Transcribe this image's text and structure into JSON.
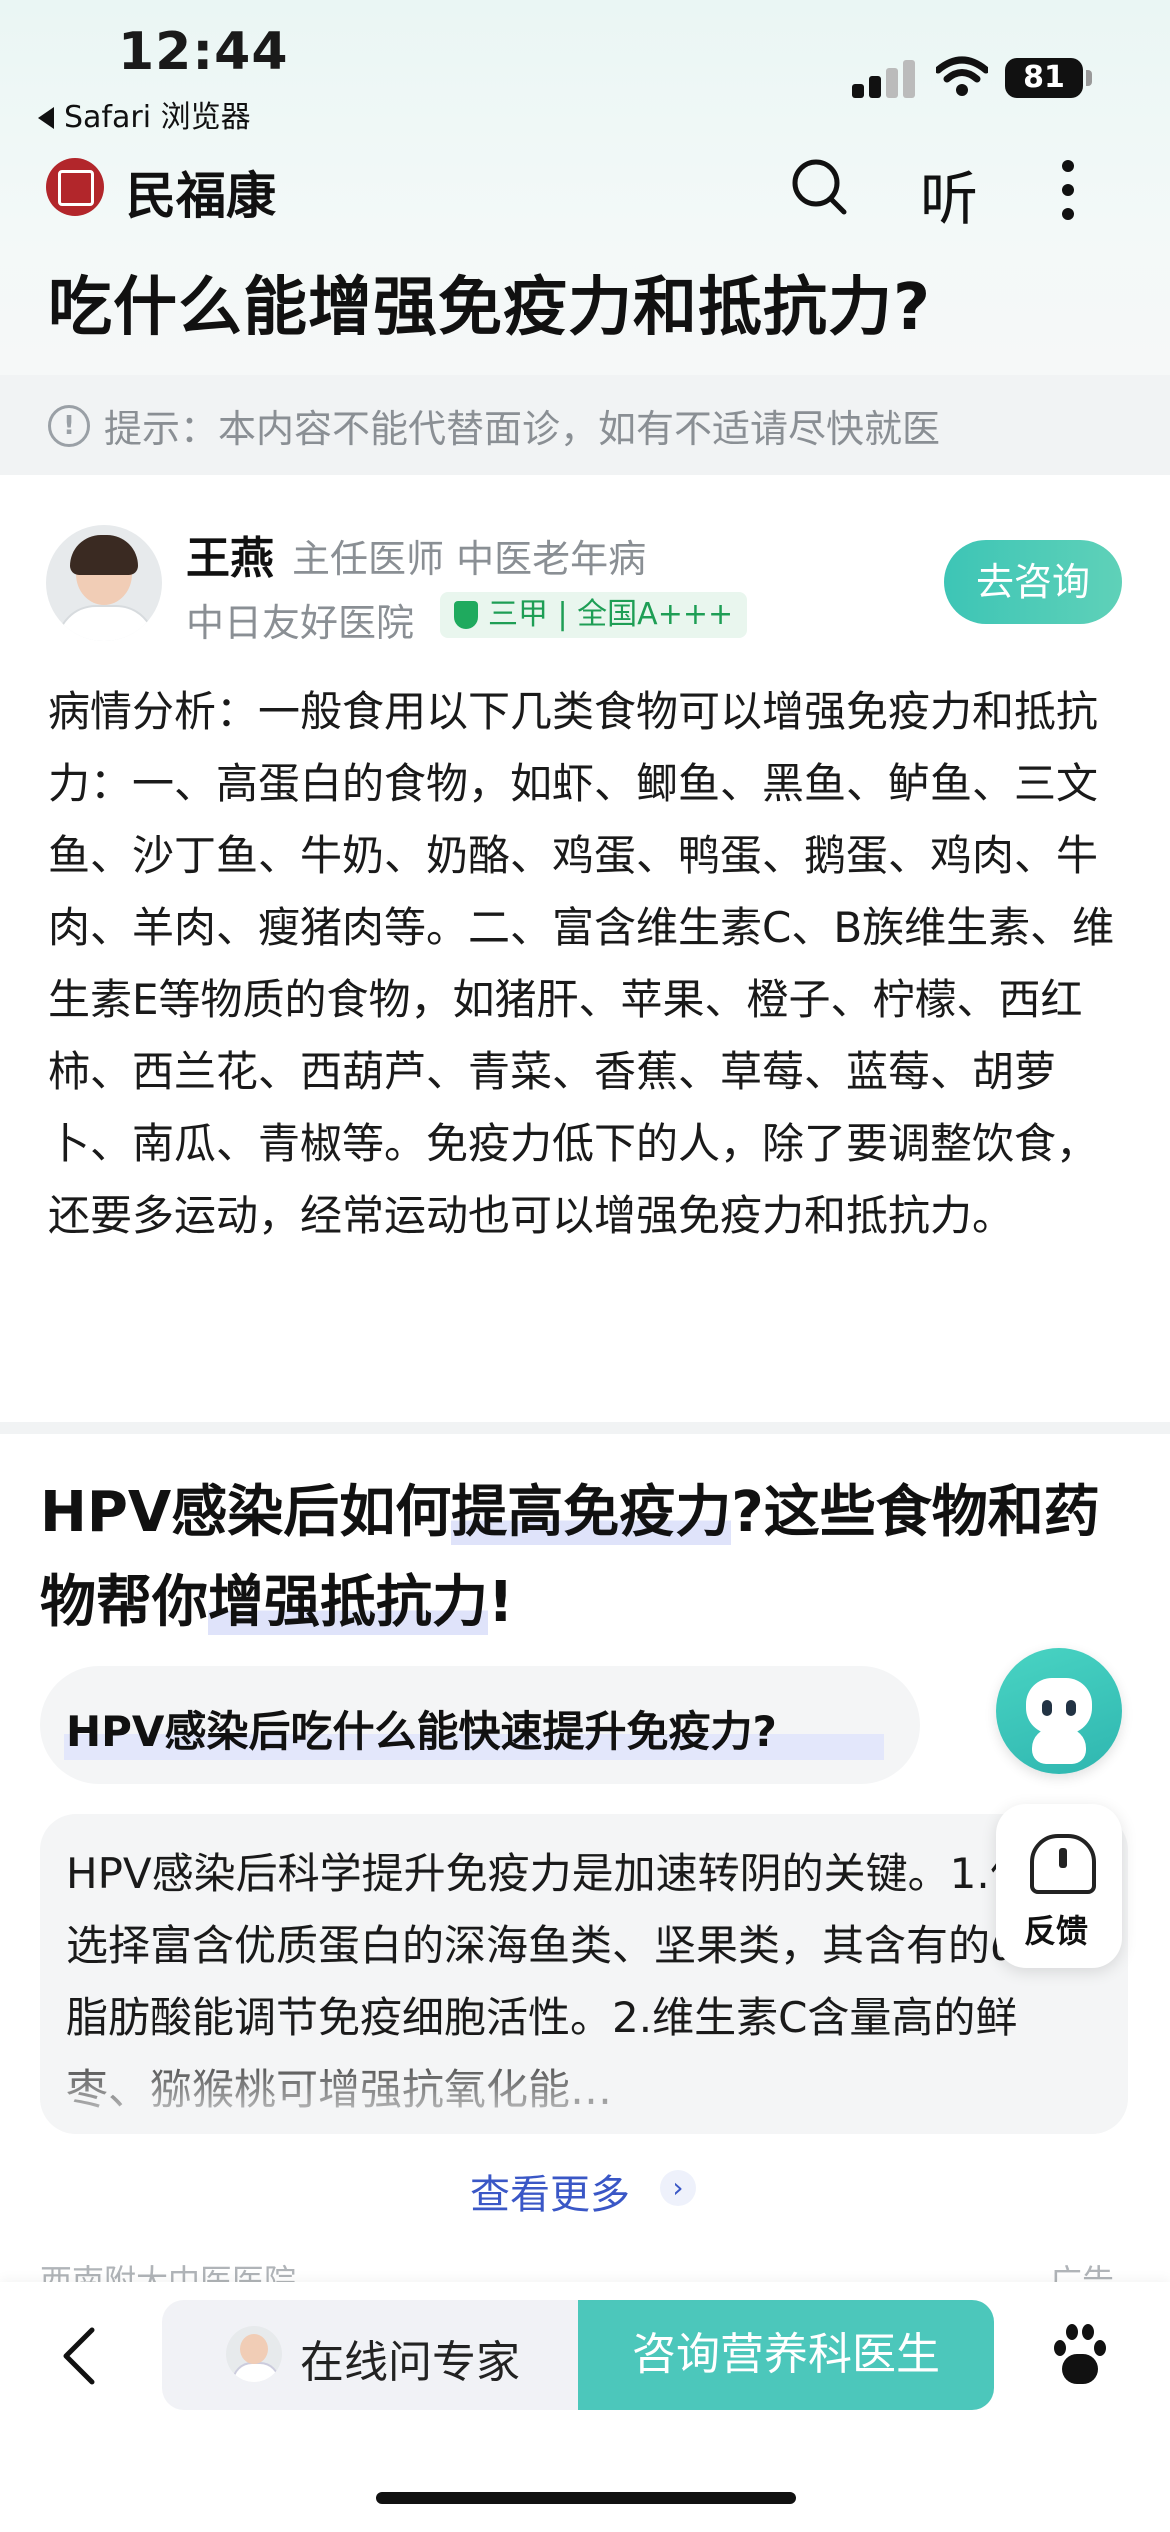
{
  "status_bar": {
    "time": "12:44",
    "back_app": "Safari 浏览器",
    "battery": "81"
  },
  "nav": {
    "brand": "民福康",
    "listen_label": "听"
  },
  "page_title": "吃什么能增强免疫力和抵抗力?",
  "tip": "提示：本内容不能代替面诊，如有不适请尽快就医",
  "doctor": {
    "name": "王燕",
    "title": "主任医师  中医老年病",
    "hospital": "中日友好医院",
    "grade": "三甲 | 全国A+++",
    "consult_button": "去咨询"
  },
  "analysis": "病情分析：一般食用以下几类食物可以增强免疫力和抵抗力：一、高蛋白的食物，如虾、鲫鱼、黑鱼、鲈鱼、三文鱼、沙丁鱼、牛奶、奶酪、鸡蛋、鸭蛋、鹅蛋、鸡肉、牛肉、羊肉、瘦猪肉等。二、富含维生素C、B族维生素、维生素E等物质的食物，如猪肝、苹果、橙子、柠檬、西红柿、西兰花、西葫芦、青菜、香蕉、草莓、蓝莓、胡萝卜、南瓜、青椒等。免疫力低下的人，除了要调整饮食，还要多运动，经常运动也可以增强免疫力和抵抗力。",
  "article": {
    "title_part1": "HPV感染后如何",
    "title_hl1": "提高免疫力",
    "title_part2": "?这些食物和药物帮你",
    "title_hl2": "增强抵抗力",
    "title_part3": "!",
    "question": "HPV感染后吃什么能快速提升免疫力?",
    "answer": "HPV感染后科学提升免疫力是加速转阴的关键。1.优先选择富含优质蛋白的深海鱼类、坚果类，其含有的ω-3脂肪酸能调节免疫细胞活性。2.维生素C含量高的鲜枣、猕猴桃可增强抗氧化能…",
    "see_more": "查看更多",
    "ad_source": "西南附大中医医院",
    "ad_label": "广告"
  },
  "floating": {
    "feedback_label": "反馈"
  },
  "bottom_bar": {
    "ask_expert": "在线问专家",
    "consult_nutrition": "咨询营养科医生"
  },
  "colors": {
    "accent_teal": "#4cc7bb",
    "link_blue": "#3a57c6",
    "brand_red": "#b2262b",
    "grade_green": "#1e9e55"
  }
}
